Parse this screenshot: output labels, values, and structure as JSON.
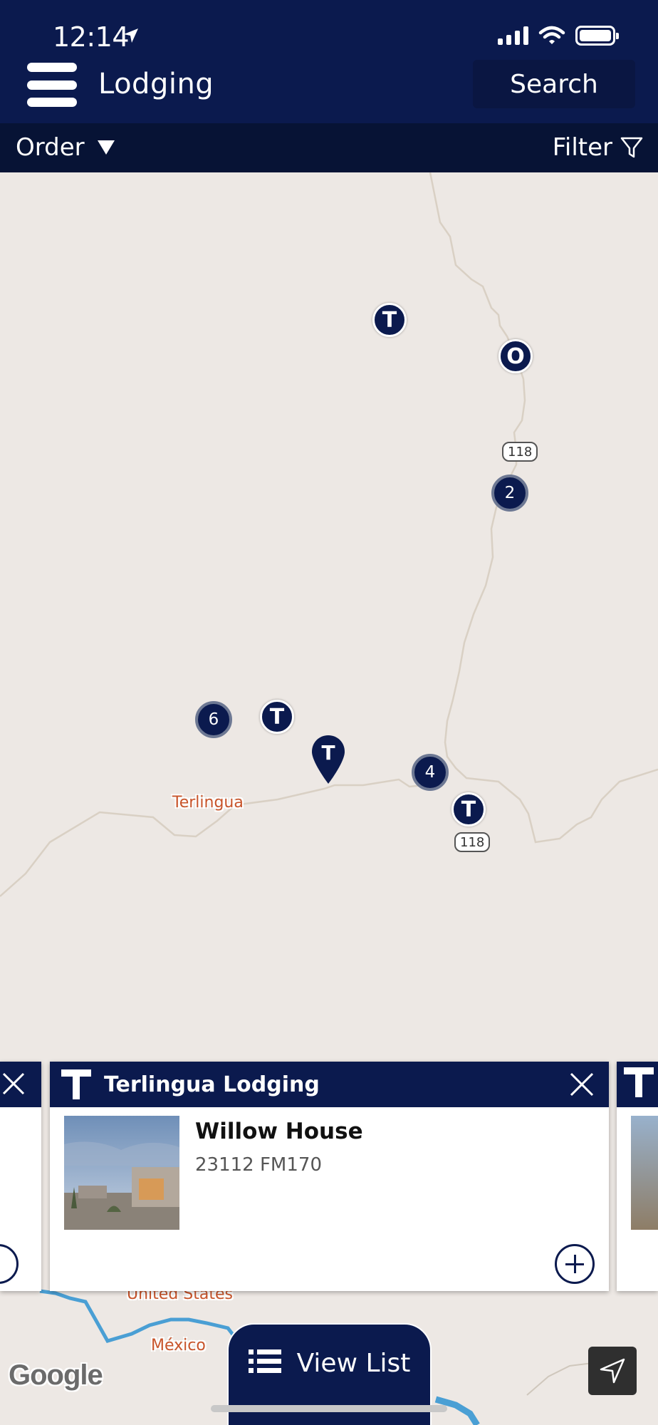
{
  "status": {
    "time": "12:14"
  },
  "header": {
    "title": "Lodging",
    "search_label": "Search"
  },
  "subbar": {
    "order_label": "Order",
    "filter_label": "Filter"
  },
  "map": {
    "markers": [
      "T",
      "O",
      "T",
      "T",
      "T"
    ],
    "pin_letter": "T",
    "clusters": [
      "2",
      "6",
      "4"
    ],
    "route_labels": [
      "118",
      "118"
    ],
    "places": [
      "Terlingua",
      "United States",
      "México"
    ],
    "attribution": "Google"
  },
  "card": {
    "category": "Terlingua Lodging",
    "name": "Willow House",
    "address": "23112 FM170"
  },
  "bottom": {
    "view_list_label": "View List"
  },
  "colors": {
    "navy": "#0b1a4e",
    "map_bg": "#ede8e4",
    "river": "#4a9fd4",
    "place_label": "#c8542a"
  }
}
